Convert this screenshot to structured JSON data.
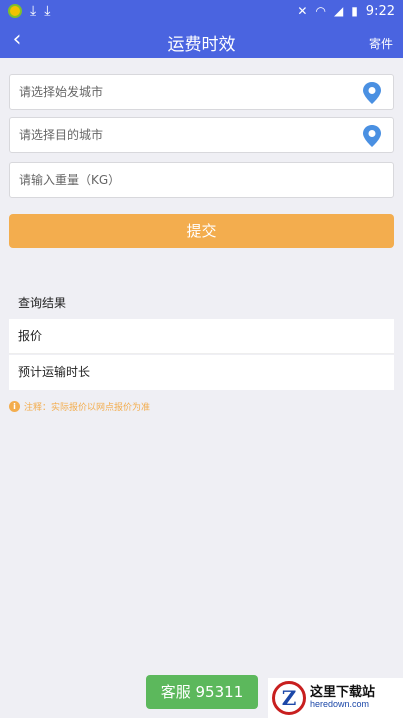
{
  "status_bar": {
    "time": "9:22",
    "icons": [
      "app-icon",
      "download-icon",
      "download-icon",
      "mute-icon",
      "wifi-icon",
      "signal-icon",
      "battery-icon"
    ]
  },
  "nav": {
    "title": "运费时效",
    "back_icon": "back-chevron-icon",
    "action_label": "寄件"
  },
  "form": {
    "origin_placeholder": "请选择始发城市",
    "destination_placeholder": "请选择目的城市",
    "weight_placeholder": "请输入重量（KG）",
    "submit_label": "提交"
  },
  "results": {
    "header": "查询结果",
    "rows": [
      {
        "label": "报价"
      },
      {
        "label": "预计运输时长"
      }
    ]
  },
  "note": {
    "icon": "info-icon",
    "text": "注释：实际报价以网点报价为准"
  },
  "service": {
    "label": "客服 95311"
  },
  "watermark_logo": {
    "letter": "Z",
    "title": "这里下载站",
    "domain": "heredown.com"
  },
  "colors": {
    "header_blue": "#4a64e0",
    "accent_orange": "#f3ad4e",
    "service_green": "#5cb85c",
    "pin_blue": "#4a90e2",
    "background": "#efeff4"
  }
}
